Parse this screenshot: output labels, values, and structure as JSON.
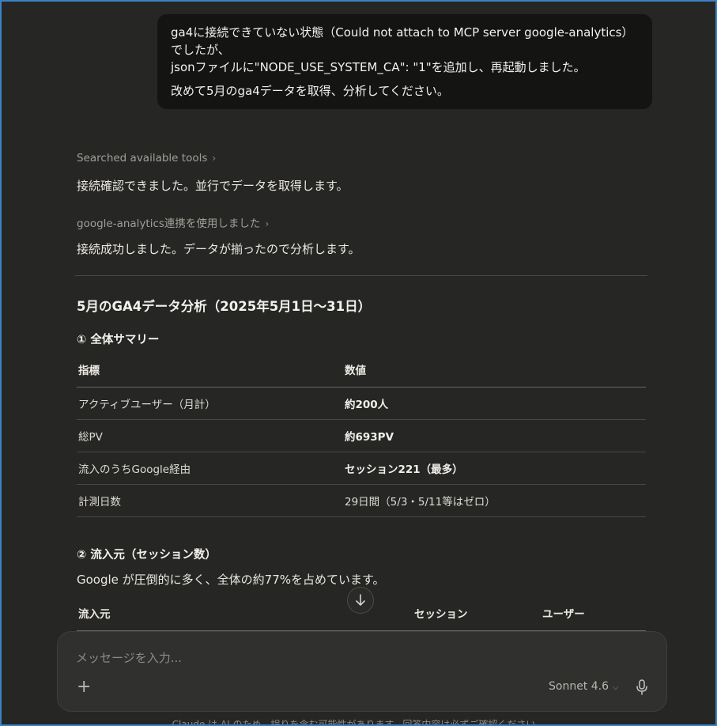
{
  "user_message": {
    "line1": "ga4に接続できていない状態（Could not attach to MCP server google-analytics）でしたが、",
    "line2": "jsonファイルに\"NODE_USE_SYSTEM_CA\": \"1\"を追加し、再起動しました。",
    "line3": "改めて5月のga4データを取得、分析してください。"
  },
  "tool_searched": "Searched available tools",
  "reply1": "接続確認できました。並行でデータを取得します。",
  "tool_ga": "google-analytics連携を使用しました",
  "reply2": "接続成功しました。データが揃ったので分析します。",
  "report": {
    "title": "5月のGA4データ分析（2025年5月1日〜31日）",
    "section1": {
      "heading": "① 全体サマリー",
      "headers": [
        "指標",
        "数値"
      ],
      "rows": [
        [
          "アクティブユーザー（月計）",
          "約200人"
        ],
        [
          "総PV",
          "約693PV"
        ],
        [
          "流入のうちGoogle経由",
          "セッション221（最多）"
        ],
        [
          "計測日数",
          "29日間（5/3・5/11等はゼロ）"
        ]
      ]
    },
    "section2": {
      "heading": "② 流入元（セッション数）",
      "text": "Google が圧倒的に多く、全体の約77%を占めています。",
      "headers": [
        "流入元",
        "セッション",
        "ユーザー"
      ]
    }
  },
  "composer": {
    "placeholder": "メッセージを入力...",
    "model": "Sonnet 4.6"
  },
  "disclaimer": "Claude は AI のため、誤りを含む可能性があります。回答内容は必ずご確認ください。",
  "icons": {
    "tool_chevron": "chevron-right-icon",
    "scroll": "arrow-down-icon",
    "add": "plus-icon",
    "model_chevron": "chevron-down-icon",
    "voice": "microphone-icon"
  }
}
